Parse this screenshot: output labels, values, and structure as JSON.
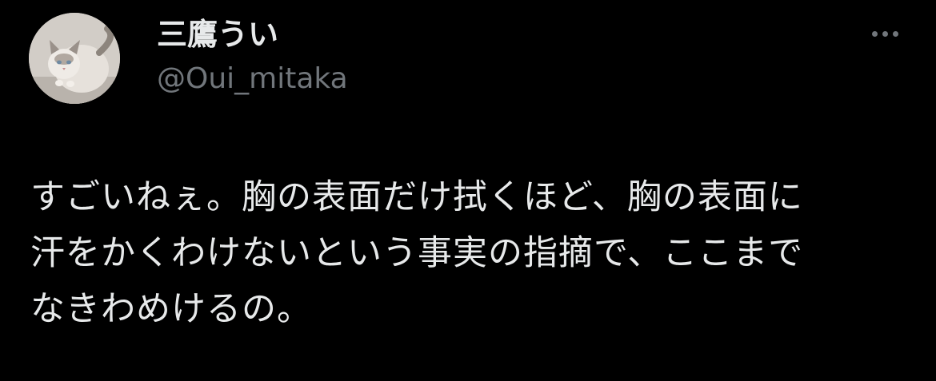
{
  "tweet": {
    "author": {
      "display_name": "三鷹うい",
      "handle": "@Oui_mitaka",
      "avatar_icon": "cat-avatar-icon"
    },
    "more_icon": "more-horizontal-icon",
    "text_lines": [
      "すごいねぇ。胸の表面だけ拭くほど、胸の表面に",
      "汗をかくわけないという事実の指摘で、ここまで",
      "なきわめけるの。"
    ]
  },
  "colors": {
    "background": "#000000",
    "primary_text": "#e7e9ea",
    "secondary_text": "#71767b"
  }
}
